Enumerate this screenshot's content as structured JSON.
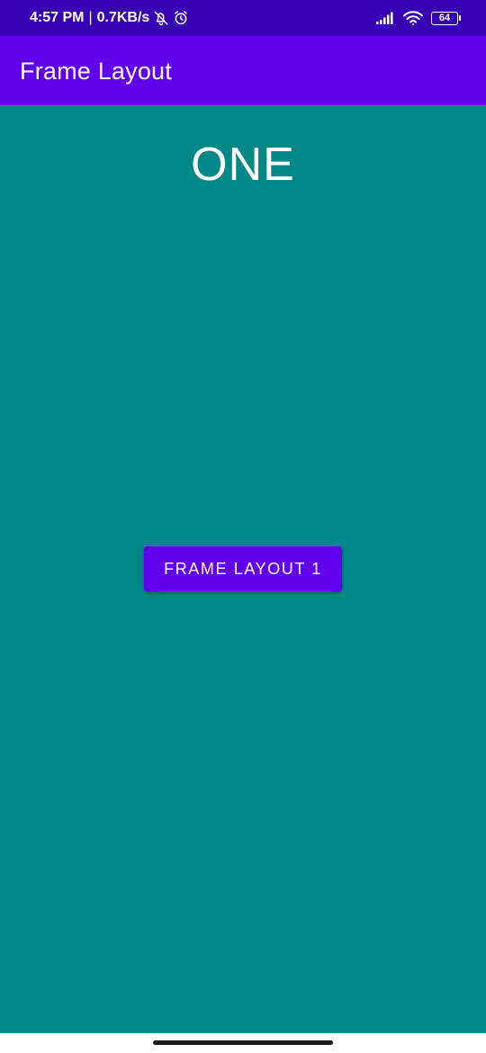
{
  "status_bar": {
    "time": "4:57 PM",
    "separator": "|",
    "net_speed": "0.7KB/s",
    "battery_level": "64",
    "icons": [
      "bell-off-icon",
      "alarm-icon",
      "signal-icon",
      "wifi-icon",
      "battery-icon"
    ],
    "background": "#3700B3"
  },
  "app_bar": {
    "title": "Frame Layout",
    "background": "#6200EE"
  },
  "content": {
    "label": "ONE",
    "button_label": "FRAME LAYOUT 1",
    "background": "#008888",
    "button_color": "#6200EE"
  }
}
